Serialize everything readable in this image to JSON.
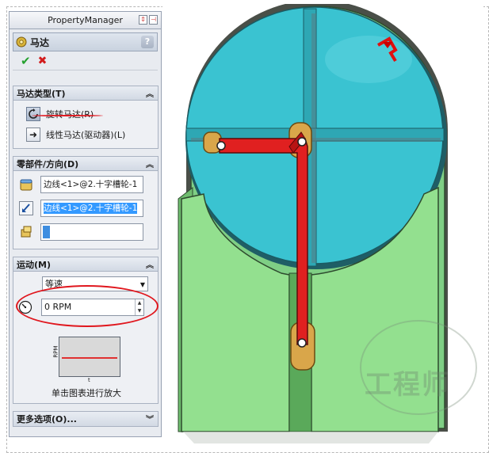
{
  "property_manager": {
    "title": "PropertyManager",
    "feature_title": "马达",
    "help_label": "?",
    "ok_icon": "check-icon",
    "cancel_icon": "x-icon"
  },
  "motor_type": {
    "header": "马达类型(T)",
    "rotary_label": "旋转马达(R)",
    "linear_label": "线性马达(驱动器)(L)",
    "selected": "rotary"
  },
  "component_direction": {
    "header": "零部件/方向(D)",
    "location_value": "边线<1>@2.十字槽轮-1",
    "direction_value": "边线<1>@2.十字槽轮-1",
    "component_value": ""
  },
  "motion": {
    "header": "运动(M)",
    "type_value": "等速",
    "speed_value": "0 RPM",
    "graph_y_label": "RPM",
    "graph_x_label": "t",
    "graph_caption": "单击图表进行放大"
  },
  "more_options": {
    "header": "更多选项(O)..."
  },
  "watermark": {
    "text": "工程师"
  },
  "colors": {
    "disc": "#35c4d3",
    "body": "#8fdc8f",
    "arm": "#e02020",
    "pin": "#d9a64a",
    "annotation": "#e0171e"
  }
}
